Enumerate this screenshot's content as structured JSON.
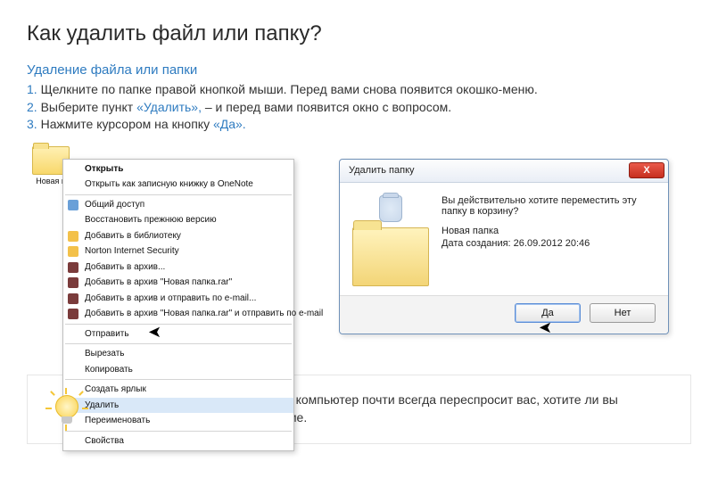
{
  "title": "Как удалить файл или папку?",
  "subtitle": "Удаление файла или папки",
  "steps": [
    {
      "num": "1.",
      "text_before": " Щелкните по папке правой кнопкой мыши. Перед вами снова появится окошко-меню.",
      "quoted": "",
      "text_after": ""
    },
    {
      "num": "2.",
      "text_before": " Выберите пункт ",
      "quoted": "«Удалить»,",
      "text_after": " – и перед вами появится окно с вопросом."
    },
    {
      "num": "3.",
      "text_before": " Нажмите курсором на кнопку ",
      "quoted": "«Да».",
      "text_after": ""
    }
  ],
  "folder": {
    "label": "Новая п"
  },
  "context_menu": {
    "items": [
      {
        "label": "Открыть",
        "bold": true
      },
      {
        "label": "Открыть как записную книжку в OneNote"
      },
      {
        "sep": true
      },
      {
        "label": "Общий доступ",
        "icon": "b"
      },
      {
        "label": "Восстановить прежнюю версию"
      },
      {
        "label": "Добавить в библиотеку",
        "icon": "a"
      },
      {
        "label": "Norton Internet Security",
        "icon": "a"
      },
      {
        "label": "Добавить в архив...",
        "icon": "c"
      },
      {
        "label": "Добавить в архив \"Новая папка.rar\"",
        "icon": "c"
      },
      {
        "label": "Добавить в архив и отправить по e-mail...",
        "icon": "c"
      },
      {
        "label": "Добавить в архив \"Новая папка.rar\" и отправить по e-mail",
        "icon": "c"
      },
      {
        "sep": true
      },
      {
        "label": "Отправить"
      },
      {
        "sep": true
      },
      {
        "label": "Вырезать"
      },
      {
        "label": "Копировать"
      },
      {
        "sep": true
      },
      {
        "label": "Создать ярлык"
      },
      {
        "label": "Удалить",
        "hl": true
      },
      {
        "label": "Переименовать"
      },
      {
        "sep": true
      },
      {
        "label": "Свойства"
      }
    ]
  },
  "dialog": {
    "title": "Удалить папку",
    "close": "X",
    "question": "Вы действительно хотите переместить эту папку в корзину?",
    "name": "Новая папка",
    "date": "Дата создания: 26.09.2012 20:46",
    "yes": "Да",
    "no": "Нет"
  },
  "tip": "Чтобы избежать случайностей, компьютер почти всегда переспросит вас, хотите ли вы совершить то или иное действие."
}
